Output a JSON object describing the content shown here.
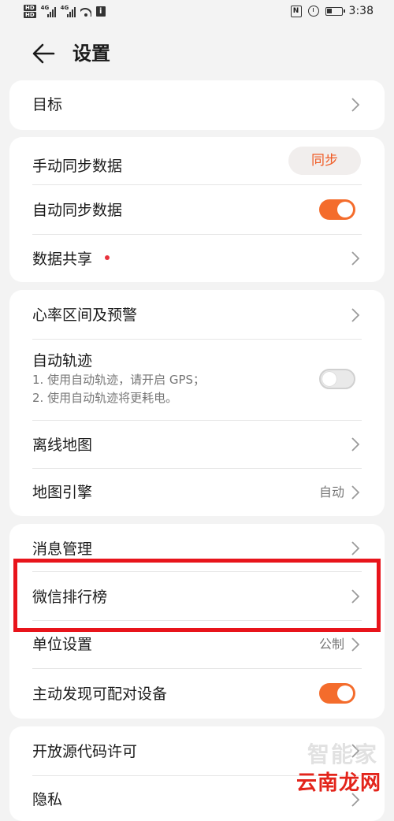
{
  "status_bar": {
    "hd1": "HD",
    "hd2": "HD",
    "net1": "4G",
    "net2": "4G",
    "nfc": "N",
    "time": "3:38"
  },
  "header": {
    "title": "设置",
    "back_icon": "arrow-left-icon"
  },
  "sections": {
    "goal": {
      "label": "目标"
    },
    "sync": {
      "manual_sync_label": "手动同步数据",
      "sync_button_label": "同步",
      "auto_sync_label": "自动同步数据",
      "auto_sync_on": true,
      "data_share_label": "数据共享"
    },
    "map": {
      "heart_rate_label": "心率区间及预警",
      "auto_track_label": "自动轨迹",
      "auto_track_hint1": "1. 使用自动轨迹，请开启 GPS；",
      "auto_track_hint2": "2. 使用自动轨迹将更耗电。",
      "auto_track_on": false,
      "offline_map_label": "离线地图",
      "map_engine_label": "地图引擎",
      "map_engine_value": "自动"
    },
    "misc": {
      "message_label": "消息管理",
      "wechat_rank_label": "微信排行榜",
      "unit_label": "单位设置",
      "unit_value": "公制",
      "discover_label": "主动发现可配对设备",
      "discover_on": true
    },
    "legal": {
      "open_source_label": "开放源代码许可",
      "privacy_label": "隐私"
    }
  },
  "watermark": {
    "faint": "智能家",
    "main": "云南龙网"
  },
  "colors": {
    "accent": "#f46c2c",
    "highlight": "#e8141b",
    "background": "#f3f3f3"
  }
}
